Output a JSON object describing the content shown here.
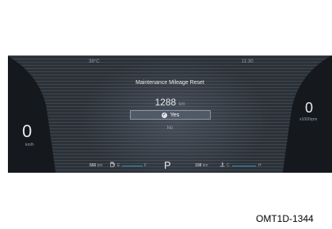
{
  "status": {
    "outside_temp": "39°C",
    "time": "11:30"
  },
  "dialog": {
    "title": "Maintenance Mileage Reset",
    "mileage_value": "1288",
    "mileage_unit": "km",
    "yes_label": "Yes",
    "no_label": "No"
  },
  "speed": {
    "value": "0",
    "unit": "km/h"
  },
  "rpm": {
    "value": "0",
    "unit": "x1000rpm"
  },
  "bottom": {
    "range_value": "666",
    "range_unit": "km",
    "fuel_empty": "E",
    "fuel_full": "F",
    "gear": "P",
    "odometer_value": "108",
    "odometer_unit": "km",
    "coolant_cold": "C",
    "coolant_hot": "H"
  },
  "figure_code": "OMT1D-1344",
  "colors": {
    "bar_accent": "#2f8fbf",
    "cluster_bg": "#2b3138"
  }
}
